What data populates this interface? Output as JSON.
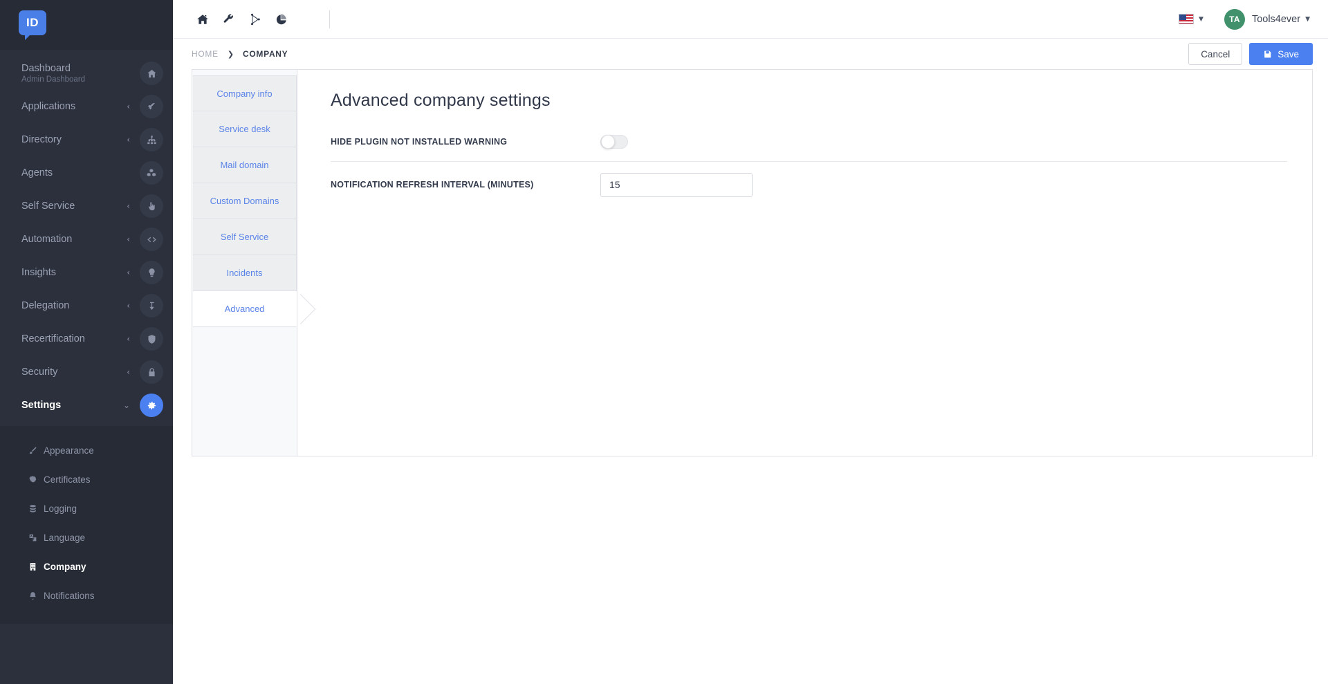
{
  "brand": {
    "logo_text": "ID",
    "accent": "#4a80ef"
  },
  "sidebar": {
    "items": [
      {
        "label": "Dashboard",
        "sublabel": "Admin Dashboard",
        "icon": "home-icon",
        "caret": "",
        "active": false
      },
      {
        "label": "Applications",
        "sublabel": "",
        "icon": "rocket-icon",
        "caret": "‹",
        "active": false
      },
      {
        "label": "Directory",
        "sublabel": "",
        "icon": "sitemap-icon",
        "caret": "‹",
        "active": false
      },
      {
        "label": "Agents",
        "sublabel": "",
        "icon": "cubes-icon",
        "caret": "",
        "active": false
      },
      {
        "label": "Self Service",
        "sublabel": "",
        "icon": "hand-pointer-icon",
        "caret": "‹",
        "active": false
      },
      {
        "label": "Automation",
        "sublabel": "",
        "icon": "code-icon",
        "caret": "‹",
        "active": false
      },
      {
        "label": "Insights",
        "sublabel": "",
        "icon": "lightbulb-icon",
        "caret": "‹",
        "active": false
      },
      {
        "label": "Delegation",
        "sublabel": "",
        "icon": "level-down-icon",
        "caret": "‹",
        "active": false
      },
      {
        "label": "Recertification",
        "sublabel": "",
        "icon": "shield-icon",
        "caret": "‹",
        "active": false
      },
      {
        "label": "Security",
        "sublabel": "",
        "icon": "lock-icon",
        "caret": "‹",
        "active": false
      },
      {
        "label": "Settings",
        "sublabel": "",
        "icon": "gear-icon",
        "caret": "⌄",
        "active": true
      }
    ],
    "submenu": [
      {
        "label": "Appearance",
        "icon": "brush-icon",
        "active": false
      },
      {
        "label": "Certificates",
        "icon": "certificate-icon",
        "active": false
      },
      {
        "label": "Logging",
        "icon": "database-icon",
        "active": false
      },
      {
        "label": "Language",
        "icon": "language-icon",
        "active": false
      },
      {
        "label": "Company",
        "icon": "building-icon",
        "active": true
      },
      {
        "label": "Notifications",
        "icon": "bell-icon",
        "active": false
      }
    ]
  },
  "topbar": {
    "icons": [
      "home-icon",
      "wrench-icon",
      "connector-icon",
      "pie-chart-icon",
      "help-icon"
    ],
    "language_flag": "us-flag-icon",
    "user": {
      "initials": "TA",
      "name": "Tools4ever"
    }
  },
  "breadcrumb": {
    "home": "HOME",
    "separator": "❯",
    "current": "COMPANY"
  },
  "actions": {
    "cancel_label": "Cancel",
    "save_label": "Save",
    "save_icon": "floppy-disk-icon"
  },
  "tabs": [
    {
      "label": "Company info",
      "active": false
    },
    {
      "label": "Service desk",
      "active": false
    },
    {
      "label": "Mail domain",
      "active": false
    },
    {
      "label": "Custom Domains",
      "active": false
    },
    {
      "label": "Self Service",
      "active": false
    },
    {
      "label": "Incidents",
      "active": false
    },
    {
      "label": "Advanced",
      "active": true
    }
  ],
  "form": {
    "title": "Advanced company settings",
    "hide_plugin_warning": {
      "label": "HIDE PLUGIN NOT INSTALLED WARNING",
      "value": false
    },
    "notification_refresh": {
      "label": "NOTIFICATION REFRESH INTERVAL (MINUTES)",
      "value": "15",
      "placeholder": ""
    }
  }
}
